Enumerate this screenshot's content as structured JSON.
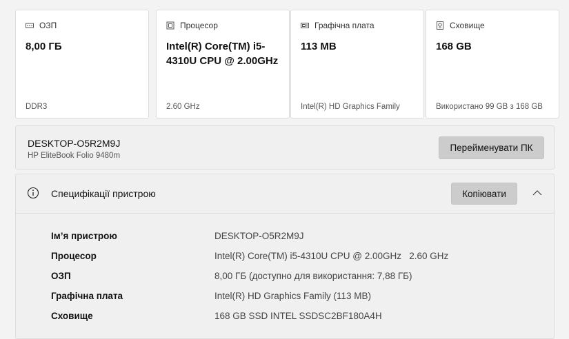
{
  "cards": [
    {
      "icon": "ram-icon",
      "title": "ОЗП",
      "value": "8,00 ГБ",
      "footer": "DDR3"
    },
    {
      "icon": "processor-icon",
      "title": "Процесор",
      "value": "Intel(R) Core(TM) i5-4310U CPU @ 2.00GHz",
      "footer": "2.60 GHz"
    },
    {
      "icon": "graphics-card-icon",
      "title": "Графічна плата",
      "value": "113 MB",
      "footer": "Intel(R) HD Graphics Family"
    },
    {
      "icon": "storage-icon",
      "title": "Сховище",
      "value": "168 GB",
      "footer": "Використано 99 GB з 168 GB"
    }
  ],
  "device": {
    "name": "DESKTOP-O5R2M9J",
    "model": "HP EliteBook Folio 9480m",
    "rename_label": "Перейменувати ПК"
  },
  "specs": {
    "icon": "info-icon",
    "title": "Специфікації пристрою",
    "copy_label": "Копіювати",
    "collapse_icon": "chevron-up-icon",
    "rows": [
      {
        "label": "Ім’я пристрою",
        "value": "DESKTOP-O5R2M9J"
      },
      {
        "label": "Процесор",
        "value": "Intel(R) Core(TM) i5-4310U CPU @ 2.00GHz   2.60 GHz"
      },
      {
        "label": "ОЗП",
        "value": "8,00 ГБ (доступно для використання: 7,88 ГБ)"
      },
      {
        "label": "Графічна плата",
        "value": "Intel(R) HD Graphics Family (113 MB)"
      },
      {
        "label": "Сховище",
        "value": "168 GB SSD INTEL SSDSC2BF180A4H"
      }
    ]
  }
}
